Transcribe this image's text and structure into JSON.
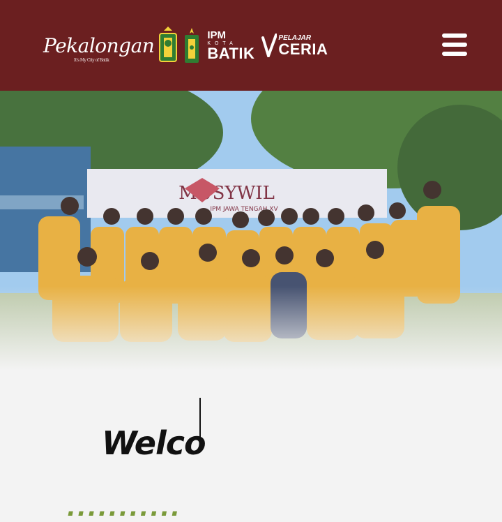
{
  "header": {
    "logos": {
      "pekalongan_script": "Pekalongan",
      "pekalongan_tagline": "It's My City of Batik",
      "ipm": "IPM",
      "kota": "KOTA",
      "batik": "BATIK",
      "pelajar": "PELAJAR",
      "ceria": "CERIA"
    },
    "menu_icon": "hamburger-menu-icon",
    "background_color": "#6b1f20"
  },
  "hero": {
    "banner_title": "MUSYWIL",
    "banner_subtitle": "IPM JAWA TENGAH XV",
    "jacket_color": "#e7ad3a",
    "sky_color": "#9ec9ee"
  },
  "main": {
    "welcome_text": "Welco",
    "cut_line_text": "..........."
  }
}
